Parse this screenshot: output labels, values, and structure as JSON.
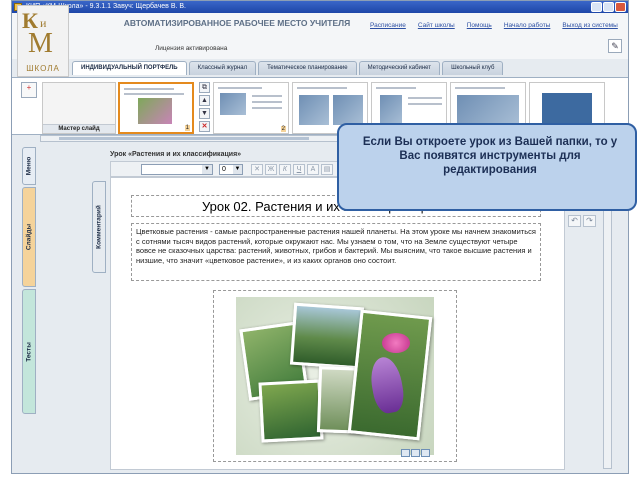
{
  "window": {
    "title": "КИП «КМ-Школа» - 9.3.1.1 Завуч: Щербачев В. В."
  },
  "header": {
    "logo": {
      "letter_k": "К",
      "letter_i": "и",
      "letter_m": "М",
      "school": "ШКОЛА"
    },
    "app_title": "АВТОМАТИЗИРОВАННОЕ РАБОЧЕЕ МЕСТО УЧИТЕЛЯ",
    "license": "Лицензия активирована",
    "links": [
      "Расписание",
      "Сайт школы",
      "Помощь",
      "Начало работы",
      "Выход из системы"
    ],
    "edit_icon": "pencil-icon"
  },
  "tabs": [
    {
      "label": "ИНДИВИДУАЛЬНЫЙ ПОРТФЕЛЬ",
      "active": true
    },
    {
      "label": "Классный журнал",
      "active": false
    },
    {
      "label": "Тематическое планирование",
      "active": false
    },
    {
      "label": "Методический кабинет",
      "active": false
    },
    {
      "label": "Школьный клуб",
      "active": false
    }
  ],
  "slide_strip": {
    "master_label": "Мастер слайд",
    "slides": [
      {
        "number": "1",
        "selected": true
      },
      {
        "number": "2",
        "selected": false
      }
    ]
  },
  "side_tabs": {
    "menu": "Меню",
    "slides": "Слайды",
    "tests": "Тесты"
  },
  "editor": {
    "lesson_label": "Урок «Растения и их классификация»",
    "comments_tab": "Комментарий",
    "font_size": "0",
    "format_buttons": [
      "Ж",
      "К",
      "Ч"
    ]
  },
  "lesson": {
    "title": "Урок 02. Растения и их классификация",
    "text": "Цветковые растения - самые распространенные растения нашей планеты. На этом уроке мы начнем знакомиться с сотнями тысяч видов растений, которые окружают нас. Мы узнаем о том, что на Земле существуют четыре вовсе не сказочных царства: растений, животных, грибов и бактерий. Мы выясним, что такое высшие растения и низшие, что значит «цветковое растение», и из каких органов оно состоит."
  },
  "callout": {
    "text": "Если Вы откроете урок из Вашей папки, то у Вас появятся инструменты для редактирования"
  }
}
